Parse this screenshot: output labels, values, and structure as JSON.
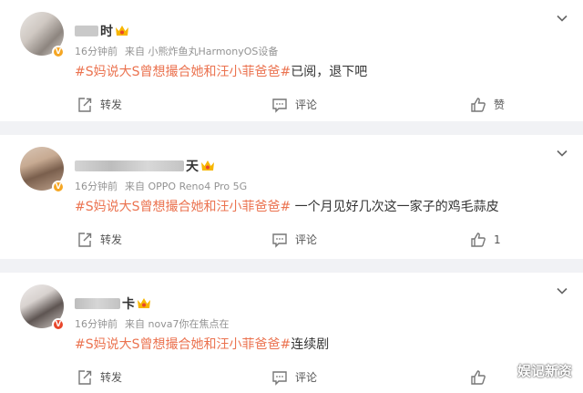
{
  "posts": [
    {
      "name_visible": "时",
      "meta_time": "16分钟前",
      "meta_source": "来自 小熊炸鱼丸HarmonyOS设备",
      "hashtag": "#S妈说大S曾想撮合她和汪小菲爸爸#",
      "text": "已阅，退下吧",
      "repost_label": "转发",
      "comment_label": "评论",
      "like_label": "赞",
      "like_count": ""
    },
    {
      "name_visible": "天",
      "meta_time": "16分钟前",
      "meta_source": "来自 OPPO Reno4 Pro 5G",
      "hashtag": "#S妈说大S曾想撮合她和汪小菲爸爸#",
      "text": " 一个月见好几次这一家子的鸡毛蒜皮",
      "repost_label": "转发",
      "comment_label": "评论",
      "like_label": "",
      "like_count": "1"
    },
    {
      "name_visible": "卡",
      "meta_time": "16分钟前",
      "meta_source": "来自 nova7你在焦点在",
      "hashtag": "#S妈说大S曾想撮合她和汪小菲爸爸#",
      "text": "连续剧",
      "repost_label": "转发",
      "comment_label": "评论",
      "like_label": "",
      "like_count": ""
    }
  ],
  "watermark": "娱记新资",
  "colors": {
    "hashtag": "#eb7350",
    "meta": "#939393",
    "background": "#f1f2f5"
  }
}
